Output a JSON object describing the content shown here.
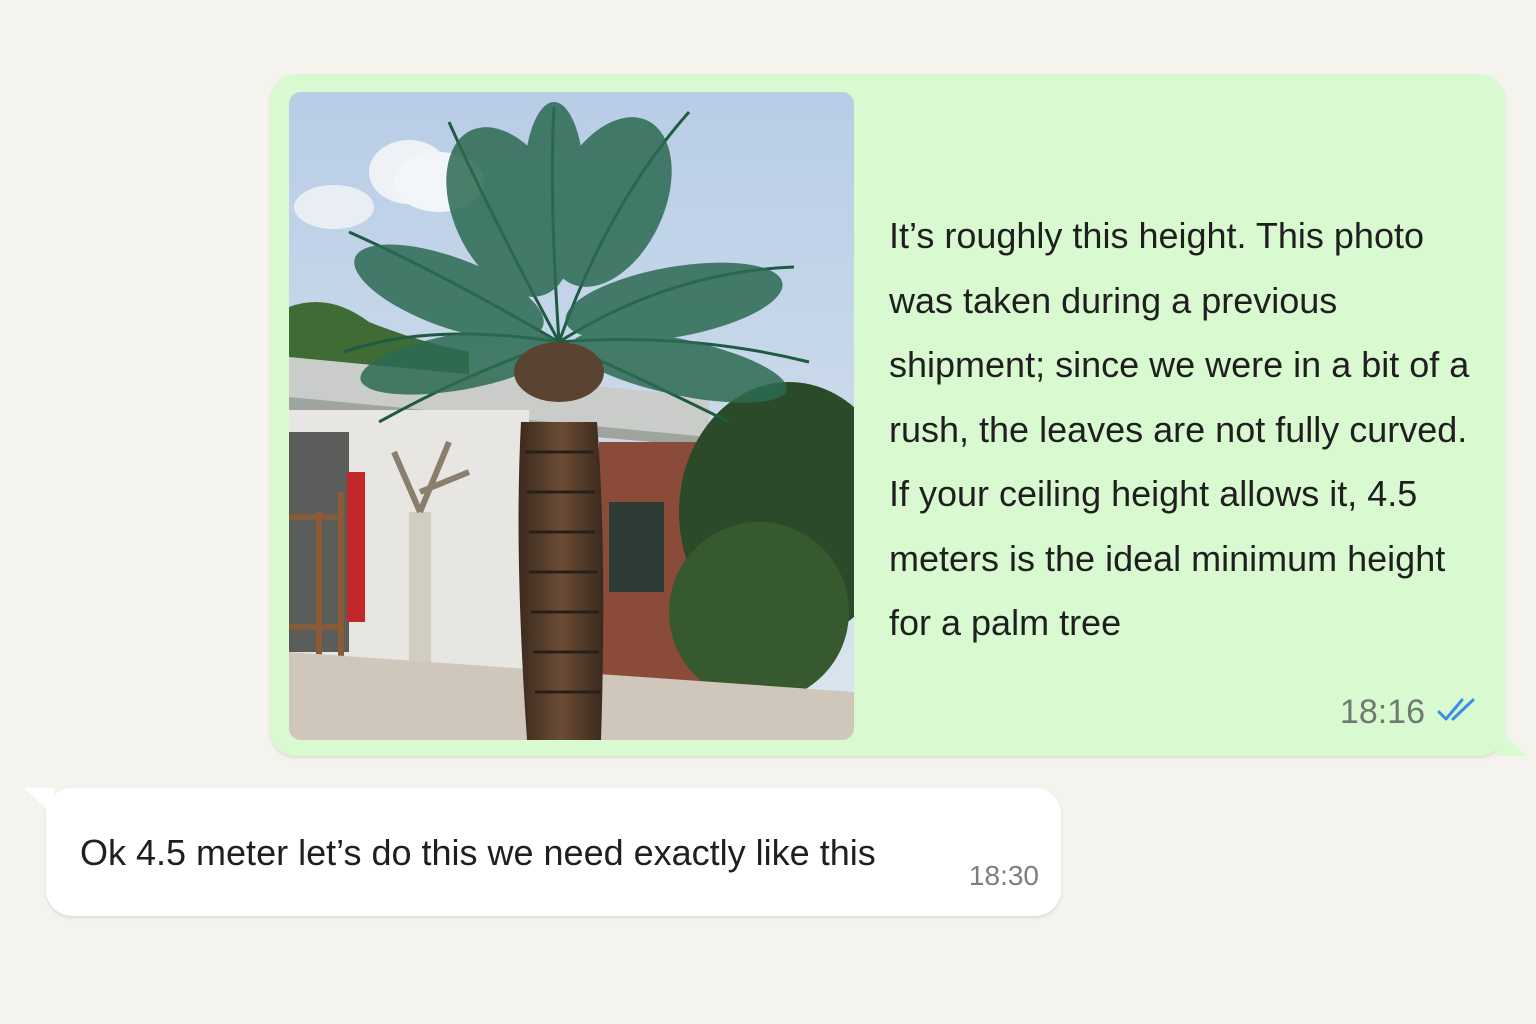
{
  "chat": {
    "outgoing": {
      "photo": {
        "description_icon": "palm-tree-photo"
      },
      "text": "It’s roughly this height. This photo\nwas taken during a previous\nshipment; since we were in a bit of a\nrush, the leaves are not fully curved.\nIf your ceiling height allows it, 4.5\nmeters is the ideal minimum height\nfor a palm tree",
      "time": "18:16",
      "status_icon": "double-check-icon",
      "bubble_color": "#d9fad0",
      "check_color": "#3a8ee6"
    },
    "incoming": {
      "text": "Ok 4.5 meter let’s do this we need exactly like this",
      "time": "18:30",
      "bubble_color": "#ffffff"
    }
  }
}
